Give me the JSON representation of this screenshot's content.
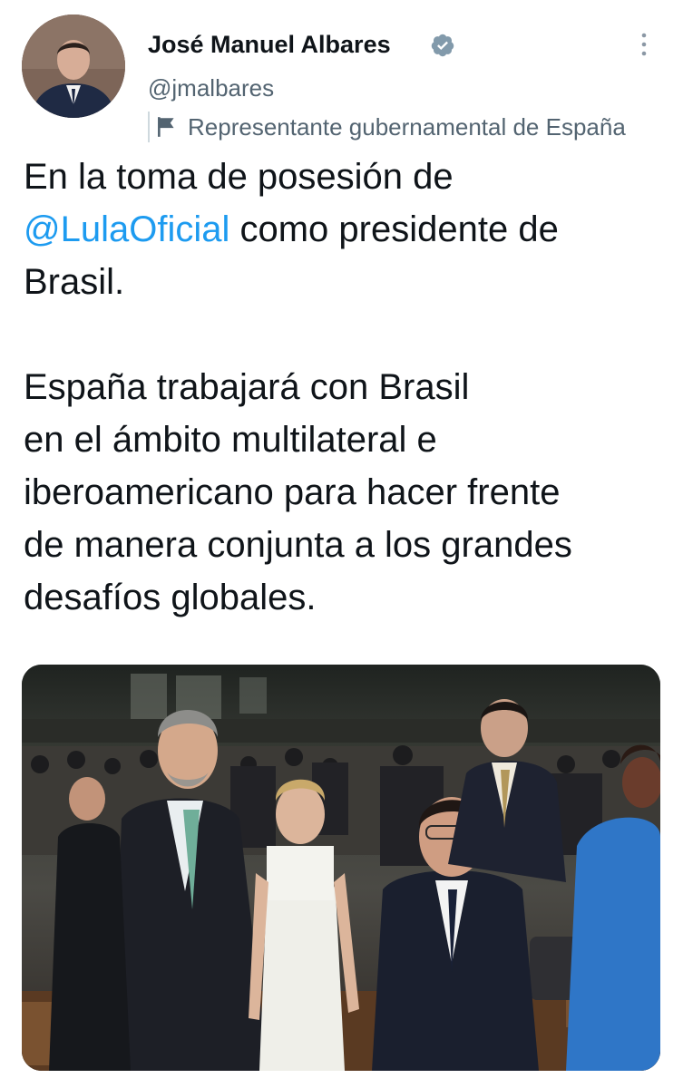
{
  "author": {
    "name": "José Manuel Albares",
    "handle": "@jmalbares",
    "label": "Representante gubernamental de España",
    "verified": true
  },
  "icons": {
    "avatar": "profile-photo",
    "verified": "verified-badge-icon",
    "label": "flag-icon",
    "more": "more-vertical-icon"
  },
  "tweet": {
    "line1_before": "En la toma de posesión de",
    "mention": "@LulaOficial",
    "line2_after": " como presidente de",
    "line3": "Brasil.",
    "para2_line1": "España trabajará con Brasil",
    "para2_line2": "en el ámbito multilateral e",
    "para2_line3": "iberoamericano para hacer frente",
    "para2_line4": "de manera conjunta a los grandes",
    "para2_line5": "desafíos globales."
  },
  "colors": {
    "text": "#0f1419",
    "secondary": "#536471",
    "link": "#1d9bf0",
    "verified": "#829aab"
  }
}
